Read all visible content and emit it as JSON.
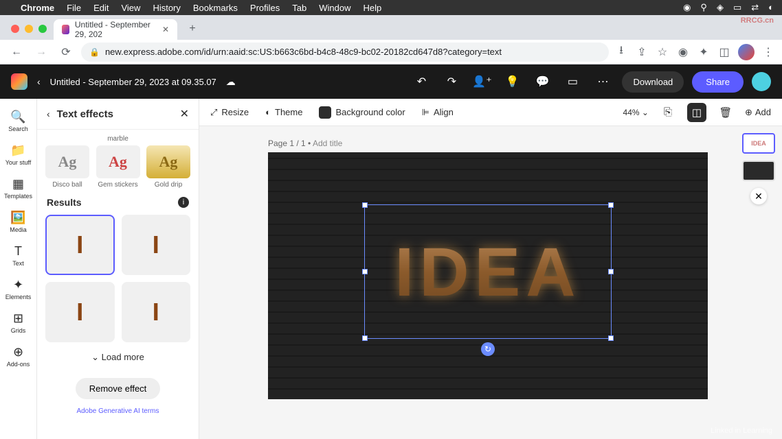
{
  "macos": {
    "app": "Chrome",
    "menus": [
      "File",
      "Edit",
      "View",
      "History",
      "Bookmarks",
      "Profiles",
      "Tab",
      "Window",
      "Help"
    ]
  },
  "chrome": {
    "tab_title": "Untitled - September 29, 202",
    "url": "new.express.adobe.com/id/urn:aaid:sc:US:b663c6bd-b4c8-48c9-bc02-20182cd647d8?category=text"
  },
  "header": {
    "doc_title": "Untitled - September 29, 2023 at 09.35.07",
    "download": "Download",
    "share": "Share"
  },
  "rail": {
    "items": [
      {
        "icon": "🔍",
        "label": "Search"
      },
      {
        "icon": "📁",
        "label": "Your stuff"
      },
      {
        "icon": "▦",
        "label": "Templates"
      },
      {
        "icon": "🖼️",
        "label": "Media"
      },
      {
        "icon": "T",
        "label": "Text"
      },
      {
        "icon": "✦",
        "label": "Elements"
      },
      {
        "icon": "⊞",
        "label": "Grids"
      },
      {
        "icon": "⊕",
        "label": "Add-ons"
      }
    ]
  },
  "panel": {
    "title": "Text effects",
    "above_label": "marble",
    "presets": [
      {
        "label": "Disco ball",
        "sample": "Ag"
      },
      {
        "label": "Gem stickers",
        "sample": "Ag"
      },
      {
        "label": "Gold drip",
        "sample": "Ag"
      }
    ],
    "results_title": "Results",
    "results": [
      "I",
      "I",
      "I",
      "I"
    ],
    "load_more": "Load more",
    "remove_effect": "Remove effect",
    "ai_terms": "Adobe Generative AI terms"
  },
  "context_bar": {
    "resize": "Resize",
    "theme": "Theme",
    "bgcolor": "Background color",
    "align": "Align",
    "zoom": "44%",
    "add": "Add"
  },
  "canvas": {
    "page_label": "Page 1 / 1",
    "add_title": "Add title",
    "text": "IDEA"
  },
  "thumbs": {
    "page1": "IDEA"
  },
  "watermarks": {
    "corner": "RRCG.cn",
    "bottom": "Linked in Learning"
  }
}
